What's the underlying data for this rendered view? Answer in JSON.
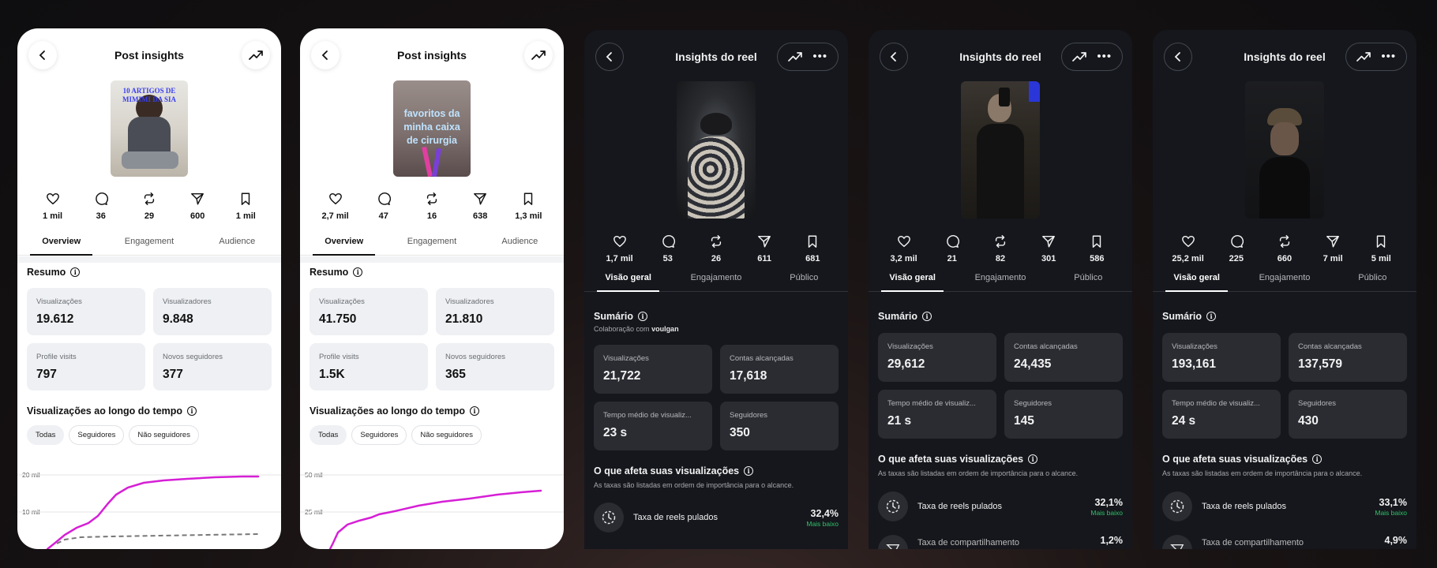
{
  "panels": [
    {
      "title": "Post insights",
      "thumb_text": "10 ARTIGOS DE MIMIMI DA SIA",
      "stats": [
        "1 mil",
        "36",
        "29",
        "600",
        "1 mil"
      ],
      "tabs": [
        "Overview",
        "Engagement",
        "Audience"
      ],
      "summary_title": "Resumo",
      "cards": [
        {
          "label": "Visualizações",
          "value": "19.612"
        },
        {
          "label": "Visualizadores",
          "value": "9.848"
        },
        {
          "label": "Profile visits",
          "value": "797"
        },
        {
          "label": "Novos seguidores",
          "value": "377"
        }
      ],
      "views_over_time": "Visualizações ao longo do tempo",
      "chips": [
        "Todas",
        "Seguidores",
        "Não seguidores"
      ],
      "chart_ticks": [
        "20 mil",
        "10 mil"
      ]
    },
    {
      "title": "Post insights",
      "thumb_text": "favoritos da minha caixa de cirurgia",
      "stats": [
        "2,7 mil",
        "47",
        "16",
        "638",
        "1,3 mil"
      ],
      "tabs": [
        "Overview",
        "Engagement",
        "Audience"
      ],
      "summary_title": "Resumo",
      "cards": [
        {
          "label": "Visualizações",
          "value": "41.750"
        },
        {
          "label": "Visualizadores",
          "value": "21.810"
        },
        {
          "label": "Profile visits",
          "value": "1.5K"
        },
        {
          "label": "Novos seguidores",
          "value": "365"
        }
      ],
      "views_over_time": "Visualizações ao longo do tempo",
      "chips": [
        "Todas",
        "Seguidores",
        "Não seguidores"
      ],
      "chart_ticks": [
        "50 mil",
        "25 mil"
      ]
    },
    {
      "title": "Insights do reel",
      "stats": [
        "1,7 mil",
        "53",
        "26",
        "611",
        "681"
      ],
      "tabs": [
        "Visão geral",
        "Engajamento",
        "Público"
      ],
      "summary_title": "Sumário",
      "collab_prefix": "Colaboração com",
      "collab_user": "voulgan",
      "cards": [
        {
          "label": "Visualizações",
          "value": "21,722"
        },
        {
          "label": "Contas alcançadas",
          "value": "17,618"
        },
        {
          "label": "Tempo médio de visualiz...",
          "value": "23 s"
        },
        {
          "label": "Seguidores",
          "value": "350"
        }
      ],
      "affects_title": "O que afeta suas visualizações",
      "affects_sub": "As taxas são listadas em ordem de importância para o alcance.",
      "factor1": {
        "name": "Taxa de reels pulados",
        "pct": "32,4%",
        "note": "Mais baixo"
      }
    },
    {
      "title": "Insights do reel",
      "stats": [
        "3,2 mil",
        "21",
        "82",
        "301",
        "586"
      ],
      "tabs": [
        "Visão geral",
        "Engajamento",
        "Público"
      ],
      "summary_title": "Sumário",
      "cards": [
        {
          "label": "Visualizações",
          "value": "29,612"
        },
        {
          "label": "Contas alcançadas",
          "value": "24,435"
        },
        {
          "label": "Tempo médio de visualiz...",
          "value": "21 s"
        },
        {
          "label": "Seguidores",
          "value": "145"
        }
      ],
      "affects_title": "O que afeta suas visualizações",
      "affects_sub": "As taxas são listadas em ordem de importância para o alcance.",
      "factor1": {
        "name": "Taxa de reels pulados",
        "pct": "32,1%",
        "note": "Mais baixo"
      },
      "factor2": {
        "name": "Taxa de compartilhamento",
        "pct": "1,2%"
      }
    },
    {
      "title": "Insights do reel",
      "stats": [
        "25,2 mil",
        "225",
        "660",
        "7 mil",
        "5 mil"
      ],
      "tabs": [
        "Visão geral",
        "Engajamento",
        "Público"
      ],
      "summary_title": "Sumário",
      "cards": [
        {
          "label": "Visualizações",
          "value": "193,161"
        },
        {
          "label": "Contas alcançadas",
          "value": "137,579"
        },
        {
          "label": "Tempo médio de visualiz...",
          "value": "24 s"
        },
        {
          "label": "Seguidores",
          "value": "430"
        }
      ],
      "affects_title": "O que afeta suas visualizações",
      "affects_sub": "As taxas são listadas em ordem de importância para o alcance.",
      "factor1": {
        "name": "Taxa de reels pulados",
        "pct": "33,1%",
        "note": "Mais baixo"
      },
      "factor2": {
        "name": "Taxa de compartilhamento",
        "pct": "4,9%"
      }
    }
  ],
  "stat_icons": [
    "heart-icon",
    "comment-icon",
    "repost-icon",
    "share-icon",
    "bookmark-icon"
  ],
  "colors": {
    "chart_line": "#d61fd6",
    "positive": "#2fc26a",
    "dark_bg": "#15171c"
  }
}
